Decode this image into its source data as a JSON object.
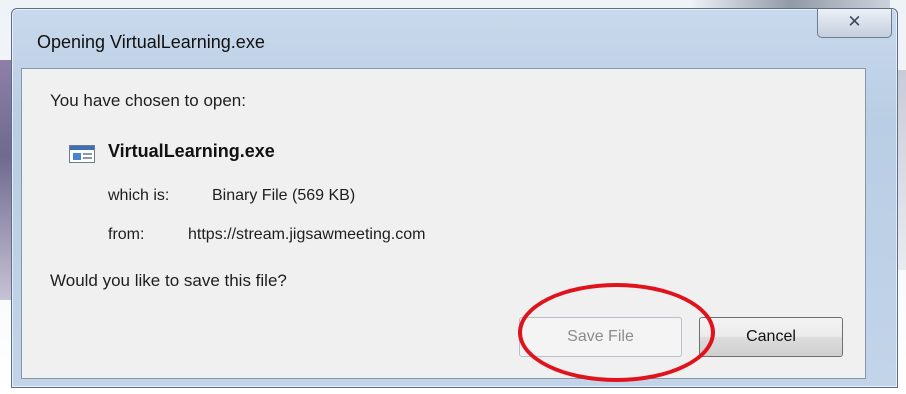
{
  "dialog": {
    "title": "Opening VirtualLearning.exe",
    "close_symbol": "✕",
    "prompt": "You have chosen to open:",
    "file": {
      "icon": "application-file-icon",
      "name": "VirtualLearning.exe",
      "type_label": "which is:",
      "type_value": "Binary File (569 KB)",
      "source_label": "from:",
      "source_value": "https://stream.jigsawmeeting.com"
    },
    "question": "Would you like to save this file?",
    "buttons": {
      "save": "Save File",
      "cancel": "Cancel"
    },
    "save_button_disabled": true
  },
  "annotation": {
    "highlight_color": "#e0121b",
    "target": "save-file-button"
  }
}
